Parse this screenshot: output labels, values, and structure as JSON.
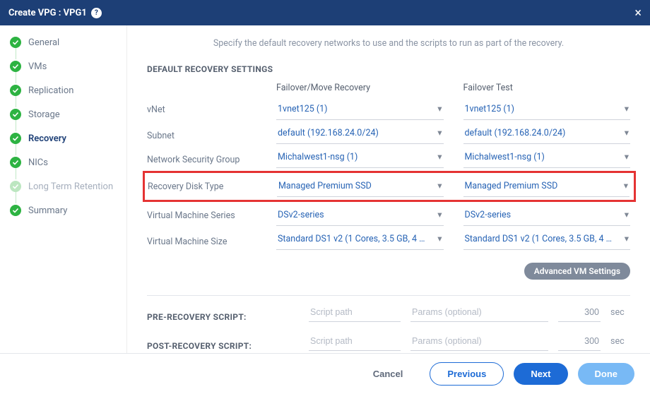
{
  "header": {
    "title": "Create VPG : VPG1"
  },
  "sidebar": {
    "steps": [
      {
        "label": "General",
        "state": "done"
      },
      {
        "label": "VMs",
        "state": "done"
      },
      {
        "label": "Replication",
        "state": "done"
      },
      {
        "label": "Storage",
        "state": "done"
      },
      {
        "label": "Recovery",
        "state": "active"
      },
      {
        "label": "NICs",
        "state": "done"
      },
      {
        "label": "Long Term Retention",
        "state": "dim"
      },
      {
        "label": "Summary",
        "state": "done"
      }
    ]
  },
  "main": {
    "intro": "Specify the default recovery networks to use and the scripts to run as part of the recovery.",
    "section_title": "DEFAULT RECOVERY SETTINGS",
    "columns": {
      "failover": "Failover/Move Recovery",
      "test": "Failover Test"
    },
    "rows": {
      "vnet": {
        "label": "vNet",
        "failover": "1vnet125 (1)",
        "test": "1vnet125 (1)"
      },
      "subnet": {
        "label": "Subnet",
        "failover": "default (192.168.24.0/24)",
        "test": "default (192.168.24.0/24)"
      },
      "nsg": {
        "label": "Network Security Group",
        "failover": "Michalwest1-nsg (1)",
        "test": "Michalwest1-nsg (1)"
      },
      "disk": {
        "label": "Recovery Disk Type",
        "failover": "Managed Premium SSD",
        "test": "Managed Premium SSD"
      },
      "series": {
        "label": "Virtual Machine Series",
        "failover": "DSv2-series",
        "test": "DSv2-series"
      },
      "size": {
        "label": "Virtual Machine Size",
        "failover": "Standard DS1 v2 (1 Cores, 3.5 GB, 4 D…",
        "test": "Standard DS1 v2 (1 Cores, 3.5 GB, 4 D…"
      }
    },
    "advanced_button": "Advanced VM Settings",
    "scripts": {
      "pre": {
        "label": "PRE-RECOVERY SCRIPT:",
        "path_ph": "Script path",
        "params_ph": "Params (optional)",
        "timeout": "300",
        "unit": "sec"
      },
      "post": {
        "label": "POST-RECOVERY SCRIPT:",
        "path_ph": "Script path",
        "params_ph": "Params (optional)",
        "timeout": "300",
        "unit": "sec"
      }
    }
  },
  "footer": {
    "cancel": "Cancel",
    "previous": "Previous",
    "next": "Next",
    "done": "Done"
  }
}
